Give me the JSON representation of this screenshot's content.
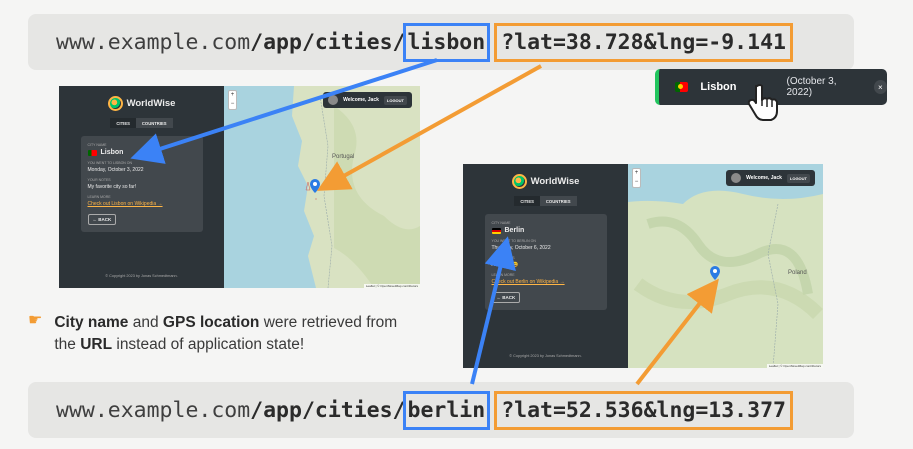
{
  "top_url": {
    "host": "www.example.com",
    "path": "/app/cities/",
    "city": "lisbon",
    "query": "?lat=38.728&lng=-9.141"
  },
  "bottom_url": {
    "host": "www.example.com",
    "path": "/app/cities/",
    "city": "berlin",
    "query": "?lat=52.536&lng=13.377"
  },
  "toast": {
    "city": "Lisbon",
    "date": "(October 3, 2022)",
    "close": "×"
  },
  "app_lisbon": {
    "brand": "WorldWise",
    "tabs": [
      "CITIES",
      "COUNTRIES"
    ],
    "city_label": "CITY NAME",
    "city": "Lisbon",
    "visited_label": "YOU WENT TO LISBON ON",
    "visited": "Monday, October 3, 2022",
    "notes_label": "YOUR NOTES",
    "notes": "My favorite city so far!",
    "learn_label": "LEARN MORE",
    "link": "Check out Lisbon on Wikipedia →",
    "back": "← BACK",
    "copyright": "© Copyright 2023 by Jonas Schmedtmann.",
    "user": "Welcome, Jack",
    "logout": "LOGOUT",
    "map_label": "Portugal",
    "attribution": "Leaflet | © OpenStreetMap contributors"
  },
  "app_berlin": {
    "brand": "WorldWise",
    "tabs": [
      "CITIES",
      "COUNTRIES"
    ],
    "city_label": "CITY NAME",
    "city": "Berlin",
    "visited_label": "YOU WENT TO BERLIN ON",
    "visited": "Thursday, October 6, 2022",
    "notes_label": "YOUR NOTES",
    "notes": "Amazing 😃",
    "learn_label": "LEARN MORE",
    "link": "Check out Berlin on Wikipedia →",
    "back": "← BACK",
    "copyright": "© Copyright 2023 by Jonas Schmedtmann.",
    "user": "Welcome, Jack",
    "logout": "LOGOUT",
    "map_label": "Poland",
    "attribution": "Leaflet | © OpenStreetMap contributors"
  },
  "note": {
    "b1": "City name",
    "t1": " and ",
    "b2": "GPS location",
    "t2": " were retrieved from the ",
    "b3": "URL",
    "t3": " instead of application state!"
  },
  "colors": {
    "city_highlight": "#3b82f6",
    "query_highlight": "#f39c34",
    "sidebar": "#2d3439",
    "card": "#42484d",
    "accent_green": "#22c55e",
    "link": "#ffb545"
  },
  "icons": {
    "hand": "pointing-hand-icon",
    "cursor": "hand-cursor-icon"
  }
}
